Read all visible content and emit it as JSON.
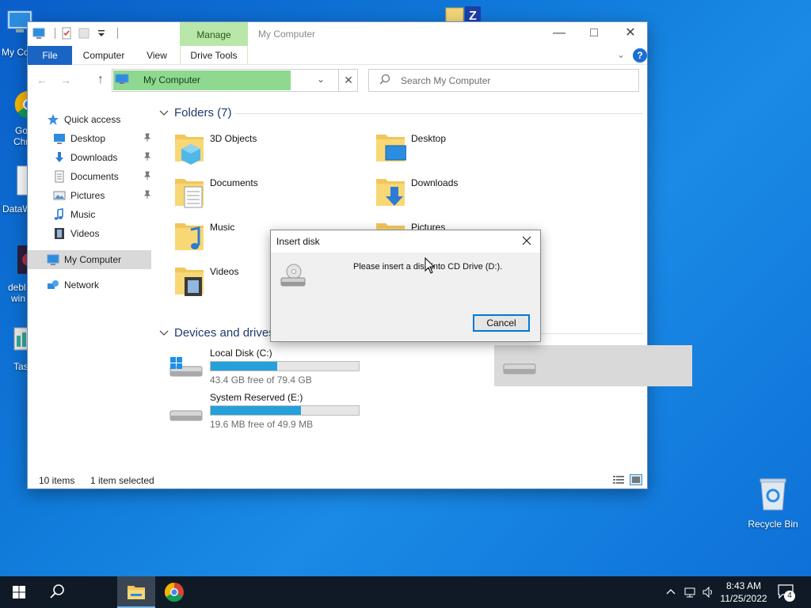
{
  "desktop": {
    "left_icons": [
      {
        "label": "My Co"
      },
      {
        "label": "Go"
      },
      {
        "label": "Chr"
      },
      {
        "label": "DataW"
      },
      {
        "label": "debl"
      },
      {
        "label": "win"
      },
      {
        "label": "Tas"
      }
    ],
    "recycle_bin": "Recycle Bin"
  },
  "window": {
    "title": "My Computer",
    "context_tab": "Manage",
    "ribbon_tabs": {
      "file": "File",
      "computer": "Computer",
      "view": "View",
      "drive_tools": "Drive Tools"
    },
    "help": "?",
    "address": "My Computer",
    "search_placeholder": "Search My Computer"
  },
  "sidebar": {
    "items": [
      {
        "label": "Quick access"
      },
      {
        "label": "Desktop"
      },
      {
        "label": "Downloads"
      },
      {
        "label": "Documents"
      },
      {
        "label": "Pictures"
      },
      {
        "label": "Music"
      },
      {
        "label": "Videos"
      },
      {
        "label": "My Computer"
      },
      {
        "label": "Network"
      }
    ]
  },
  "content": {
    "folders_header": "Folders (7)",
    "folders": [
      {
        "name": "3D Objects"
      },
      {
        "name": "Desktop"
      },
      {
        "name": "Documents"
      },
      {
        "name": "Downloads"
      },
      {
        "name": "Music"
      },
      {
        "name": "Pictures"
      },
      {
        "name": "Videos"
      }
    ],
    "drives_header": "Devices and drives",
    "drives": [
      {
        "name": "Local Disk (C:)",
        "space": "43.4 GB free of 79.4 GB",
        "used_fraction": 0.45
      },
      {
        "name": "System Reserved (E:)",
        "space": "19.6 MB free of 49.9 MB",
        "used_fraction": 0.61
      }
    ]
  },
  "status": {
    "items": "10 items",
    "selected": "1 item selected"
  },
  "dialog": {
    "title": "Insert disk",
    "message": "Please insert a disk into CD Drive (D:).",
    "cancel": "Cancel"
  },
  "taskbar": {
    "time": "8:43 AM",
    "date": "11/25/2022",
    "notifications": "4"
  },
  "colors": {
    "accent": "#0078d7",
    "drive_bar": "#26a0da",
    "manage_tab": "#b9e6a9",
    "address_highlight": "#8fd890"
  }
}
